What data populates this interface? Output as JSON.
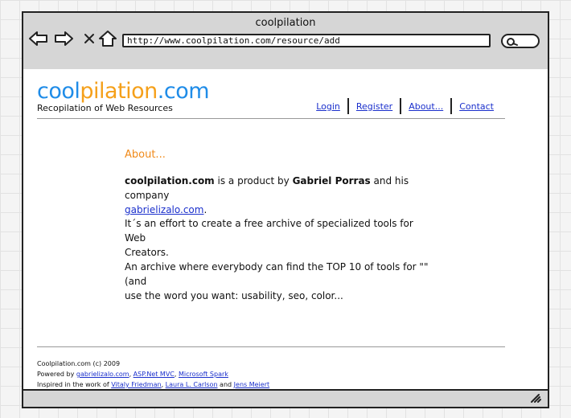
{
  "window": {
    "title": "coolpilation",
    "address": "http://www.coolpilation.com/resource/add"
  },
  "site": {
    "logo_part1": "cool",
    "logo_part2": "pilation",
    "logo_part3": ".com",
    "tagline": "Recopilation of Web Resources"
  },
  "nav": {
    "login": "Login",
    "register": "Register",
    "about": "About...",
    "contact": "Contact"
  },
  "about": {
    "title": "About...",
    "p1_brand": "coolpilation.com",
    "p1_text1": " is a product by ",
    "p1_name": "Gabriel Porras",
    "p1_text2": " and his company",
    "p1_link": "gabrielizalo.com",
    "p1_end": ".",
    "p2_line1": "It´s an effort to create a free archive of specialized tools for Web",
    "p2_line2": "Creators.",
    "p2_line3": "An archive where everybody can find the TOP 10 of tools for \"\" (and",
    "p2_line4": "use the word you want: usability, seo, color..."
  },
  "footer": {
    "copyright": "Coolpilation.com (c) 2009",
    "powered_by": "Powered by ",
    "powered_link1": "gabrielizalo.com",
    "comma1": ", ",
    "powered_link2": "ASP.Net MVC",
    "comma2": ", ",
    "powered_link3": "Microsoft Spark",
    "inspired": "Inspired in the work of ",
    "inspired_link1": "Vitaly Friedman",
    "comma3": ", ",
    "inspired_link2": "Laura L. Carlson",
    "and": " and ",
    "inspired_link3": "Jens Meiert"
  },
  "icons": {
    "back": "arrow-left-icon",
    "forward": "arrow-right-icon",
    "stop": "close-icon",
    "home": "home-icon",
    "search": "search-icon",
    "resize": "resize-grip-icon"
  },
  "colors": {
    "logo_blue": "#1f8ce8",
    "logo_orange": "#f5a01a",
    "link": "#1a2fcc",
    "heading_orange": "#f08a1a"
  }
}
